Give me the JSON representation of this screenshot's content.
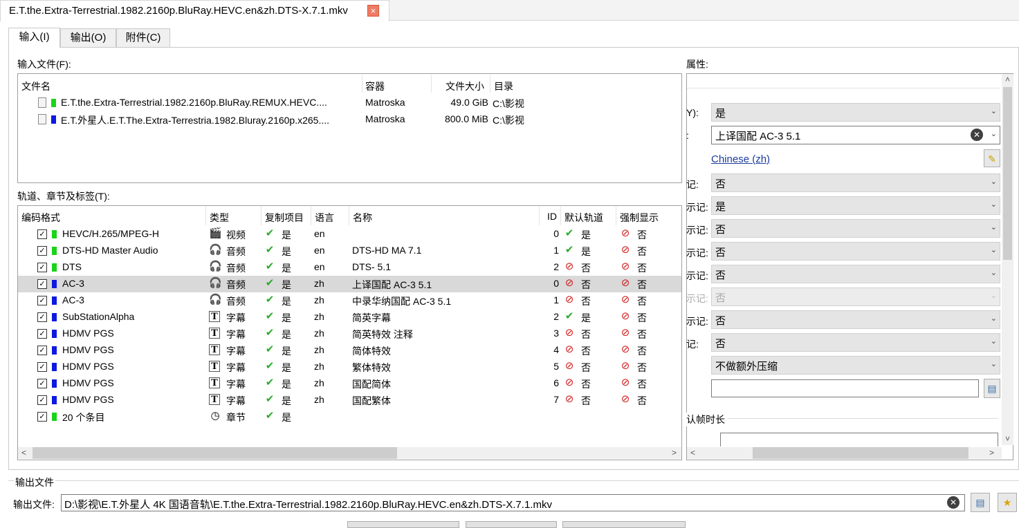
{
  "document_tab": {
    "title": "E.T.the.Extra-Terrestrial.1982.2160p.BluRay.HEVC.en&zh.DTS-X.7.1.mkv",
    "close": "×"
  },
  "page_tabs": [
    {
      "label": "输入(I)",
      "active": true
    },
    {
      "label": "输出(O)",
      "active": false
    },
    {
      "label": "附件(C)",
      "active": false
    }
  ],
  "input_files": {
    "label": "输入文件(F):",
    "columns": [
      "文件名",
      "容器",
      "文件大小",
      "目录"
    ],
    "rows": [
      {
        "name": "E.T.the.Extra-Terrestrial.1982.2160p.BluRay.REMUX.HEVC....",
        "container": "Matroska",
        "size": "49.0 GiB",
        "dir": "C:\\影视",
        "color": "#19d419"
      },
      {
        "name": "E.T.外星人.E.T.The.Extra-Terrestria.1982.Bluray.2160p.x265....",
        "container": "Matroska",
        "size": "800.0 MiB",
        "dir": "C:\\影视",
        "color": "#0d19e0"
      }
    ]
  },
  "tracks": {
    "label": "轨道、章节及标签(T):",
    "columns": [
      "编码格式",
      "类型",
      "复制项目",
      "语言",
      "名称",
      "ID",
      "默认轨道",
      "强制显示"
    ],
    "rows": [
      {
        "codec": "HEVC/H.265/MPEG-H",
        "type": "视频",
        "icon": "video-icon",
        "copy": "是",
        "lang": "en",
        "name": "",
        "id": "0",
        "default": "是",
        "default_yes": true,
        "forced": "否",
        "color": "#19d419",
        "selected": false
      },
      {
        "codec": "DTS-HD Master Audio",
        "type": "音频",
        "icon": "headphones-icon",
        "copy": "是",
        "lang": "en",
        "name": "DTS-HD MA 7.1",
        "id": "1",
        "default": "是",
        "default_yes": true,
        "forced": "否",
        "color": "#19d419",
        "selected": false
      },
      {
        "codec": "DTS",
        "type": "音频",
        "icon": "headphones-icon",
        "copy": "是",
        "lang": "en",
        "name": "DTS- 5.1",
        "id": "2",
        "default": "否",
        "default_yes": false,
        "forced": "否",
        "color": "#19d419",
        "selected": false
      },
      {
        "codec": "AC-3",
        "type": "音频",
        "icon": "headphones-icon",
        "copy": "是",
        "lang": "zh",
        "name": "上译国配 AC-3 5.1",
        "id": "0",
        "default": "否",
        "default_yes": false,
        "forced": "否",
        "color": "#0d19e0",
        "selected": true
      },
      {
        "codec": "AC-3",
        "type": "音频",
        "icon": "headphones-icon",
        "copy": "是",
        "lang": "zh",
        "name": "中录华纳国配 AC-3 5.1",
        "id": "1",
        "default": "否",
        "default_yes": false,
        "forced": "否",
        "color": "#0d19e0",
        "selected": false
      },
      {
        "codec": "SubStationAlpha",
        "type": "字幕",
        "icon": "subtitle-icon",
        "copy": "是",
        "lang": "zh",
        "name": "简英字幕",
        "id": "2",
        "default": "是",
        "default_yes": true,
        "forced": "否",
        "color": "#0d19e0",
        "selected": false
      },
      {
        "codec": "HDMV PGS",
        "type": "字幕",
        "icon": "subtitle-icon",
        "copy": "是",
        "lang": "zh",
        "name": "简英特效 注释",
        "id": "3",
        "default": "否",
        "default_yes": false,
        "forced": "否",
        "color": "#0d19e0",
        "selected": false
      },
      {
        "codec": "HDMV PGS",
        "type": "字幕",
        "icon": "subtitle-icon",
        "copy": "是",
        "lang": "zh",
        "name": "简体特效",
        "id": "4",
        "default": "否",
        "default_yes": false,
        "forced": "否",
        "color": "#0d19e0",
        "selected": false
      },
      {
        "codec": "HDMV PGS",
        "type": "字幕",
        "icon": "subtitle-icon",
        "copy": "是",
        "lang": "zh",
        "name": "繁体特效",
        "id": "5",
        "default": "否",
        "default_yes": false,
        "forced": "否",
        "color": "#0d19e0",
        "selected": false
      },
      {
        "codec": "HDMV PGS",
        "type": "字幕",
        "icon": "subtitle-icon",
        "copy": "是",
        "lang": "zh",
        "name": "国配简体",
        "id": "6",
        "default": "否",
        "default_yes": false,
        "forced": "否",
        "color": "#0d19e0",
        "selected": false
      },
      {
        "codec": "HDMV PGS",
        "type": "字幕",
        "icon": "subtitle-icon",
        "copy": "是",
        "lang": "zh",
        "name": "国配繁体",
        "id": "7",
        "default": "否",
        "default_yes": false,
        "forced": "否",
        "color": "#0d19e0",
        "selected": false
      },
      {
        "codec": "20 个条目",
        "type": "章节",
        "icon": "clock-icon",
        "copy": "是",
        "lang": "",
        "name": "",
        "id": "",
        "default": "",
        "default_yes": null,
        "forced": "",
        "color": "#19d419",
        "selected": false
      }
    ]
  },
  "properties": {
    "label": "属性:",
    "rows": [
      {
        "label": "Y):",
        "value": "是",
        "type": "combo"
      },
      {
        "label": ":",
        "value": "上译国配 AC-3 5.1",
        "type": "text"
      },
      {
        "label": "",
        "value": "Chinese (zh)",
        "type": "link"
      },
      {
        "label": "记:",
        "value": "否",
        "type": "combo"
      },
      {
        "label": "示记:",
        "value": "是",
        "type": "combo"
      },
      {
        "label": "示记:",
        "value": "否",
        "type": "combo"
      },
      {
        "label": "示记:",
        "value": "否",
        "type": "combo"
      },
      {
        "label": "示记:",
        "value": "否",
        "type": "combo"
      },
      {
        "label": "示记:",
        "value": "否",
        "type": "combo",
        "disabled": true
      },
      {
        "label": "示记:",
        "value": "否",
        "type": "combo"
      },
      {
        "label": "记:",
        "value": "否",
        "type": "combo"
      },
      {
        "label": "",
        "value": "不做额外压缩",
        "type": "combo"
      },
      {
        "label": "",
        "value": "",
        "type": "input"
      }
    ],
    "group_label": "认帧时长"
  },
  "output": {
    "group_label": "输出文件",
    "field_label": "输出文件:",
    "value": "D:\\影视\\E.T.外星人 4K  国语音轨\\E.T.the.Extra-Terrestrial.1982.2160p.BluRay.HEVC.en&zh.DTS-X.7.1.mkv"
  },
  "colors": {
    "green": "#19d419",
    "blue": "#0d19e0",
    "selection": "#d9d9d9",
    "check": "#2eaa2e",
    "deny": "#d21b1b"
  }
}
